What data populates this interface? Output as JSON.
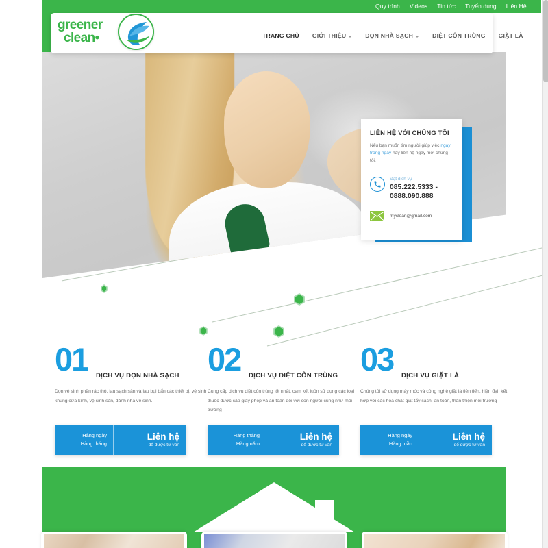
{
  "topbar": {
    "links": [
      {
        "label": "Quy trình"
      },
      {
        "label": "Videos"
      },
      {
        "label": "Tin tức"
      },
      {
        "label": "Tuyển dụng"
      },
      {
        "label": "Liên Hệ"
      }
    ]
  },
  "brand": {
    "line1": "greener",
    "line2": "clean•",
    "logo_icon": "wave-leaf-circle-logo"
  },
  "mainnav": {
    "items": [
      {
        "label": "TRANG CHỦ",
        "active": true,
        "caret": false
      },
      {
        "label": "GIỚI THIỆU",
        "active": false,
        "caret": true
      },
      {
        "label": "DỌN NHÀ SẠCH",
        "active": false,
        "caret": true
      },
      {
        "label": "DIỆT CÔN TRÙNG",
        "active": false,
        "caret": false
      },
      {
        "label": "GIẶT LÀ",
        "active": false,
        "caret": false
      }
    ]
  },
  "hero": {
    "image_alt": "woman in white shirt cleaning a surface with a yellow cloth"
  },
  "contact_card": {
    "title": "LIÊN HỆ VỚI CHÚNG TÔI",
    "desc_before": "Nếu bạn muốn tìm người giúp việc ",
    "desc_highlight": "ngay trong ngày",
    "desc_after": " hãy liên hệ ngay mới chúng tôi.",
    "phone_label": "Đặt dịch vụ",
    "phone_number": "085.222.5333 - 0888.090.888",
    "email": "myclean@gmail.com",
    "phone_icon": "phone-icon",
    "mail_icon": "envelope-icon",
    "accent_color": "#1b8fd4",
    "mail_icon_color": "#8dc63f"
  },
  "services": [
    {
      "number": "01",
      "name": "DỊCH VỤ DỌN NHÀ SẠCH",
      "desc": "Dọn vệ sinh phần rác thô, lau sạch sàn và lau bụi bẩn các thiết bị, vệ sinh khung cửa kính, vệ sinh sàn, đánh nhà vệ sinh.",
      "freq_line1": "Hàng ngày",
      "freq_line2": "Hàng tháng",
      "cta_big": "Liên hệ",
      "cta_small": "để được tư vấn"
    },
    {
      "number": "02",
      "name": "DỊCH VỤ DIỆT CÔN TRÙNG",
      "desc": "Cung cấp dịch vụ diệt côn trùng tốt nhất, cam kết luôn sử dụng các loại thuốc được cấp giấy phép và an toàn đối với con người cũng như môi trường",
      "freq_line1": "Hàng tháng",
      "freq_line2": "Hàng năm",
      "cta_big": "Liên hệ",
      "cta_small": "để được tư vấn"
    },
    {
      "number": "03",
      "name": "DỊCH VỤ GIẶT LÀ",
      "desc": "Chúng tôi sử dụng máy móc và công nghệ giặt là tiên tiến, hiện đại, kết hợp với các hóa chất giặt tẩy sạch, an toàn, thân thiện môi trường",
      "freq_line1": "Hàng ngày",
      "freq_line2": "Hàng tuần",
      "cta_big": "Liên hệ",
      "cta_small": "để được tư vấn"
    }
  ],
  "green_section": {
    "house_icon": "house-roof-icon",
    "background_color": "#3bb54a",
    "cards": [
      {
        "image_alt": "bunk bed room interior"
      },
      {
        "image_alt": "white ceiling and wall interior"
      },
      {
        "image_alt": "bright room with wooden trim"
      }
    ]
  },
  "colors": {
    "green": "#3bb54a",
    "blue": "#1b93d8",
    "number_blue": "#1b9ee0",
    "lime": "#8dc63f"
  }
}
